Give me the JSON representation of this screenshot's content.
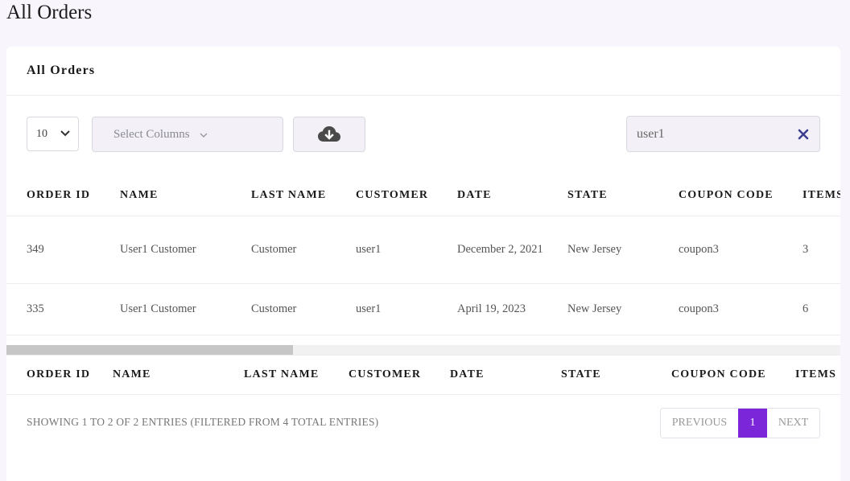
{
  "page": {
    "title": "All Orders"
  },
  "card": {
    "title": "All Orders"
  },
  "toolbar": {
    "length_value": "10",
    "columns_placeholder": "Select Columns",
    "search_value": "user1"
  },
  "table": {
    "headers": [
      "ORDER ID",
      "NAME",
      "LAST NAME",
      "CUSTOMER",
      "DATE",
      "STATE",
      "COUPON CODE",
      "ITEMS"
    ],
    "rows": [
      [
        "349",
        "User1 Customer",
        "Customer",
        "user1",
        "December 2, 2021",
        "New Jersey",
        "coupon3",
        "3"
      ],
      [
        "335",
        "User1 Customer",
        "Customer",
        "user1",
        "April 19, 2023",
        "New Jersey",
        "coupon3",
        "6"
      ]
    ]
  },
  "footer": {
    "info": "SHOWING 1 TO 2 OF 2 ENTRIES (FILTERED FROM 4 TOTAL ENTRIES)",
    "prev_label": "PREVIOUS",
    "page_number": "1",
    "next_label": "NEXT"
  },
  "colors": {
    "accent": "#7b26d9",
    "clear_icon": "#3b3f8f"
  },
  "icons": {
    "download": "cloud-download-icon",
    "clear": "close-icon",
    "dropdown": "chevron-down-icon"
  }
}
